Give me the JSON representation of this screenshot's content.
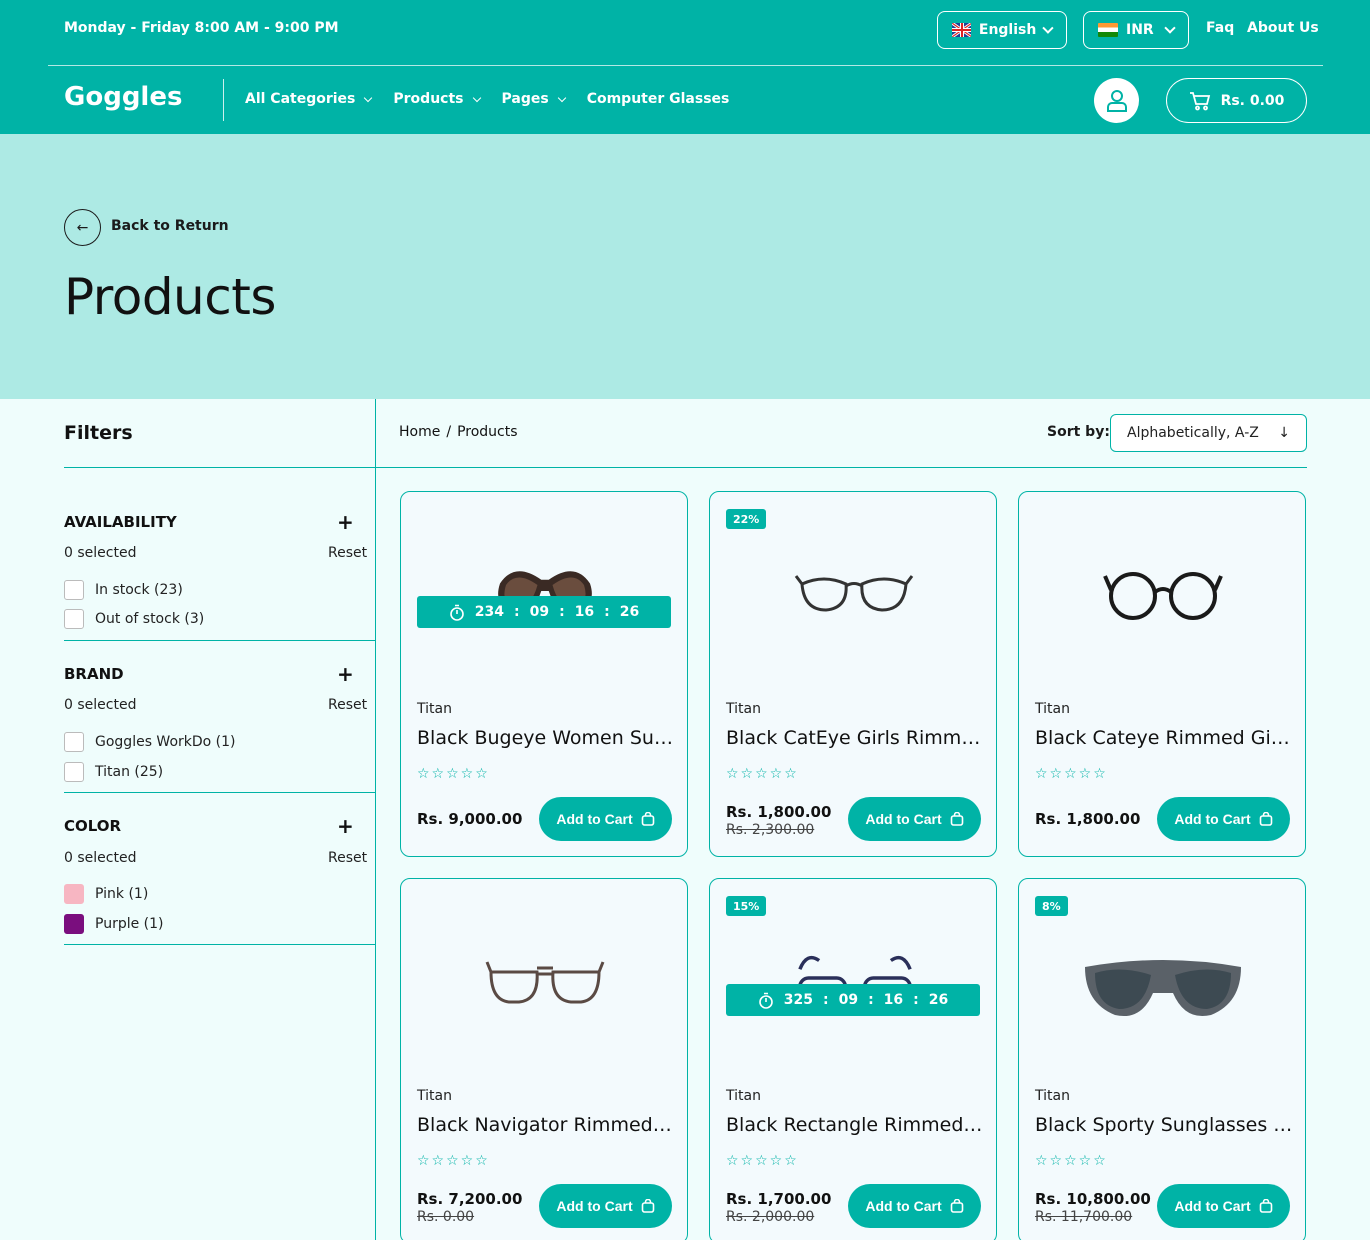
{
  "topbar": {
    "hours": "Monday - Friday   8:00 AM - 9:00 PM"
  },
  "language": {
    "label": "English"
  },
  "currency": {
    "label": "INR"
  },
  "toplinks": {
    "faq": "Faq",
    "about": "About Us"
  },
  "logo": "Goggles",
  "nav": {
    "all_categories": "All Categories",
    "products": "Products",
    "pages": "Pages",
    "computer_glasses": "Computer Glasses"
  },
  "cart": {
    "total": "Rs. 0.00"
  },
  "hero": {
    "back_label": "Back to Return",
    "title": "Products"
  },
  "filters": {
    "title": "Filters",
    "reset_label": "Reset",
    "groups": [
      {
        "title": "AVAILABILITY",
        "selected": "0 selected",
        "options": [
          "In stock (23)",
          "Out of stock (3)"
        ]
      },
      {
        "title": "BRAND",
        "selected": "0 selected",
        "options": [
          "Goggles WorkDo (1)",
          "Titan (25)"
        ]
      },
      {
        "title": "COLOR",
        "selected": "0 selected",
        "options": [
          "Pink (1)",
          "Purple (1)"
        ]
      }
    ],
    "color_swatches": {
      "pink": "#f7b6c2",
      "purple": "#7a0e7e"
    }
  },
  "breadcrumb": {
    "home": "Home",
    "sep": "/",
    "current": "Products"
  },
  "sort": {
    "label": "Sort by:",
    "value": "Alphabetically, A-Z"
  },
  "add_to_cart": "Add to Cart",
  "accent_color": "#00b3a6",
  "products": [
    {
      "brand": "Titan",
      "name": "Black Bugeye Women Sunglasses",
      "price": "Rs. 9,000.00",
      "timer": [
        "234",
        "09",
        "16",
        "26"
      ]
    },
    {
      "brand": "Titan",
      "name": "Black CatEye Girls Rimmed Eyeglasses",
      "price": "Rs. 1,800.00",
      "old_price": "Rs. 2,300.00",
      "badge": "22%"
    },
    {
      "brand": "Titan",
      "name": "Black Cateye Rimmed Girls Eyeglasses",
      "price": "Rs. 1,800.00"
    },
    {
      "brand": "Titan",
      "name": "Black Navigator Rimmed Eyeglasses",
      "price": "Rs. 7,200.00",
      "old_price": "Rs. 0.00"
    },
    {
      "brand": "Titan",
      "name": "Black Rectangle Rimmed Eyeglasses",
      "price": "Rs. 1,700.00",
      "old_price": "Rs. 2,000.00",
      "badge": "15%",
      "timer": [
        "325",
        "09",
        "16",
        "26"
      ]
    },
    {
      "brand": "Titan",
      "name": "Black Sporty Sunglasses for Men",
      "price": "Rs. 10,800.00",
      "old_price": "Rs. 11,700.00",
      "badge": "8%"
    }
  ]
}
